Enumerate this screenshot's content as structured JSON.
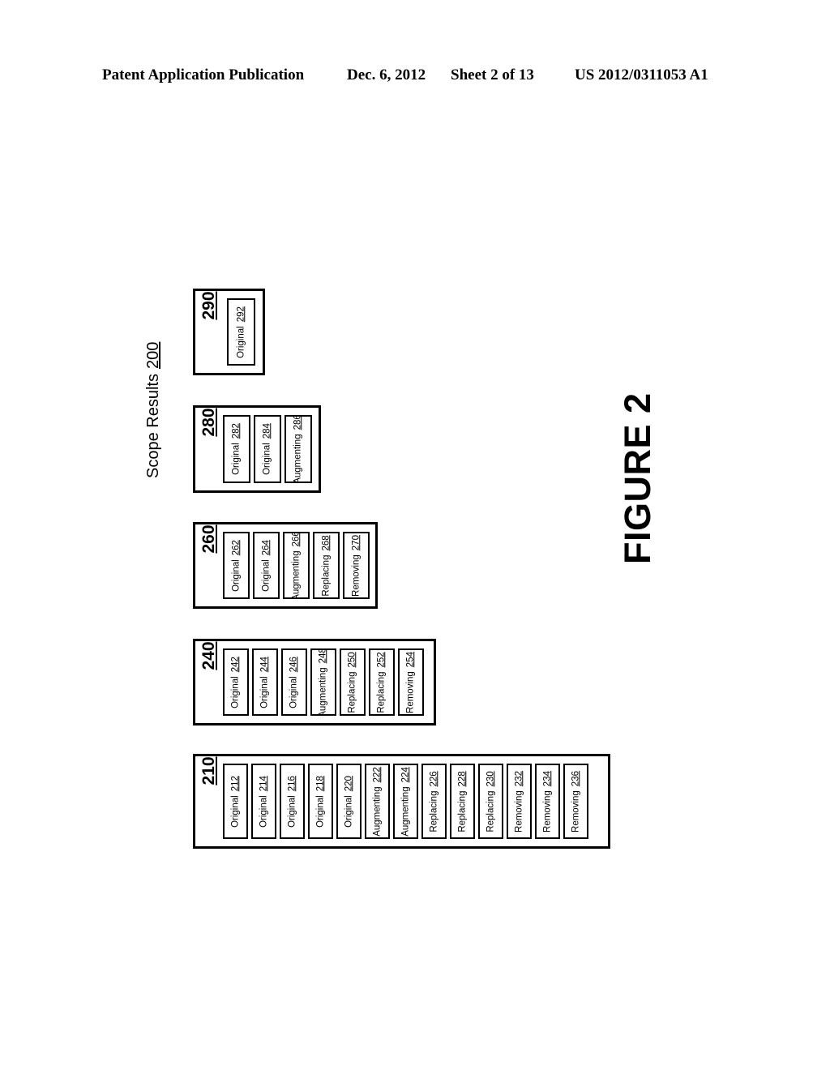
{
  "header": {
    "publication": "Patent Application Publication",
    "date": "Dec. 6, 2012",
    "sheet": "Sheet 2 of 13",
    "doc_number": "US 2012/0311053 A1"
  },
  "figure": {
    "label": "FIGURE 2",
    "caption_text": "Scope Results",
    "caption_ref": "200"
  },
  "colors": {
    "ink": "#000000",
    "paper": "#ffffff"
  },
  "groups": [
    {
      "id": "290",
      "number": "290",
      "items": [
        {
          "label": "Original",
          "ref": "292"
        }
      ]
    },
    {
      "id": "280",
      "number": "280",
      "items": [
        {
          "label": "Original",
          "ref": "282"
        },
        {
          "label": "Original",
          "ref": "284"
        },
        {
          "label": "Augmenting",
          "ref": "286"
        }
      ]
    },
    {
      "id": "260",
      "number": "260",
      "items": [
        {
          "label": "Original",
          "ref": "262"
        },
        {
          "label": "Original",
          "ref": "264"
        },
        {
          "label": "Augmenting",
          "ref": "266"
        },
        {
          "label": "Replacing",
          "ref": "268"
        },
        {
          "label": "Removing",
          "ref": "270"
        }
      ]
    },
    {
      "id": "240",
      "number": "240",
      "items": [
        {
          "label": "Original",
          "ref": "242"
        },
        {
          "label": "Original",
          "ref": "244"
        },
        {
          "label": "Original",
          "ref": "246"
        },
        {
          "label": "Augmenting",
          "ref": "248"
        },
        {
          "label": "Replacing",
          "ref": "250"
        },
        {
          "label": "Replacing",
          "ref": "252"
        },
        {
          "label": "Removing",
          "ref": "254"
        }
      ]
    },
    {
      "id": "210",
      "number": "210",
      "items": [
        {
          "label": "Original",
          "ref": "212"
        },
        {
          "label": "Original",
          "ref": "214"
        },
        {
          "label": "Original",
          "ref": "216"
        },
        {
          "label": "Original",
          "ref": "218"
        },
        {
          "label": "Original",
          "ref": "220"
        },
        {
          "label": "Augmenting",
          "ref": "222"
        },
        {
          "label": "Augmenting",
          "ref": "224"
        },
        {
          "label": "Replacing",
          "ref": "226"
        },
        {
          "label": "Replacing",
          "ref": "228"
        },
        {
          "label": "Replacing",
          "ref": "230"
        },
        {
          "label": "Removing",
          "ref": "232"
        },
        {
          "label": "Removing",
          "ref": "234"
        },
        {
          "label": "Removing",
          "ref": "236"
        }
      ]
    }
  ]
}
